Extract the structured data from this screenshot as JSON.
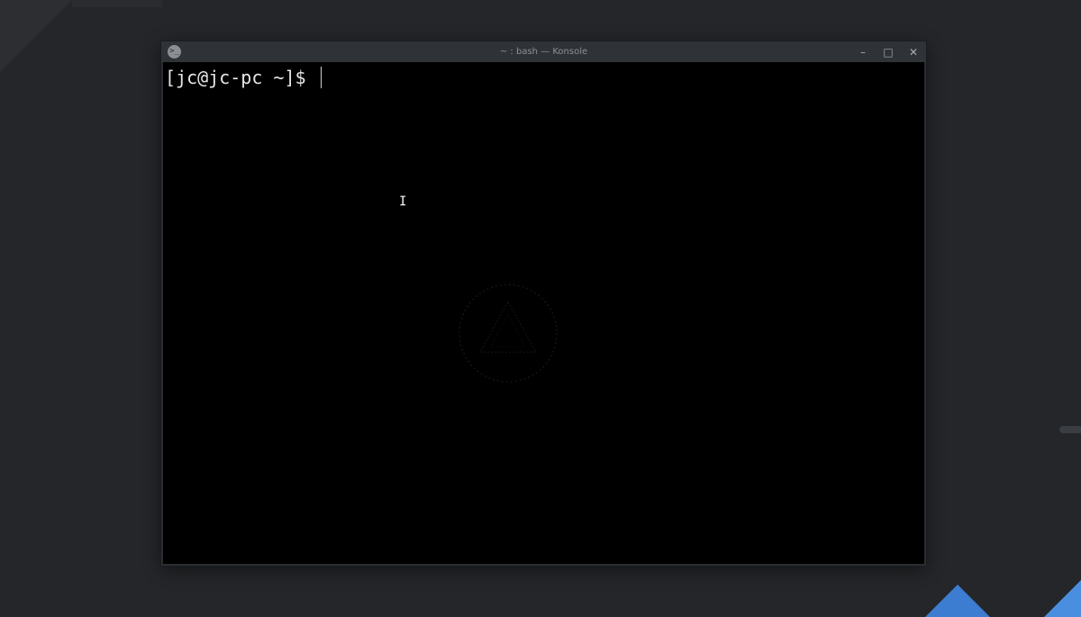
{
  "window": {
    "title": "~ : bash — Konsole",
    "app_icon": "konsole-icon",
    "controls": {
      "minimize": "–",
      "maximize": "□",
      "close": "✕"
    }
  },
  "terminal": {
    "prompt": "[jc@jc-pc ~]$ ",
    "mouse_cursor": "I"
  },
  "colors": {
    "desktop_bg": "#242629",
    "terminal_bg": "#000000",
    "accent_blue": "#3d7dd1"
  }
}
